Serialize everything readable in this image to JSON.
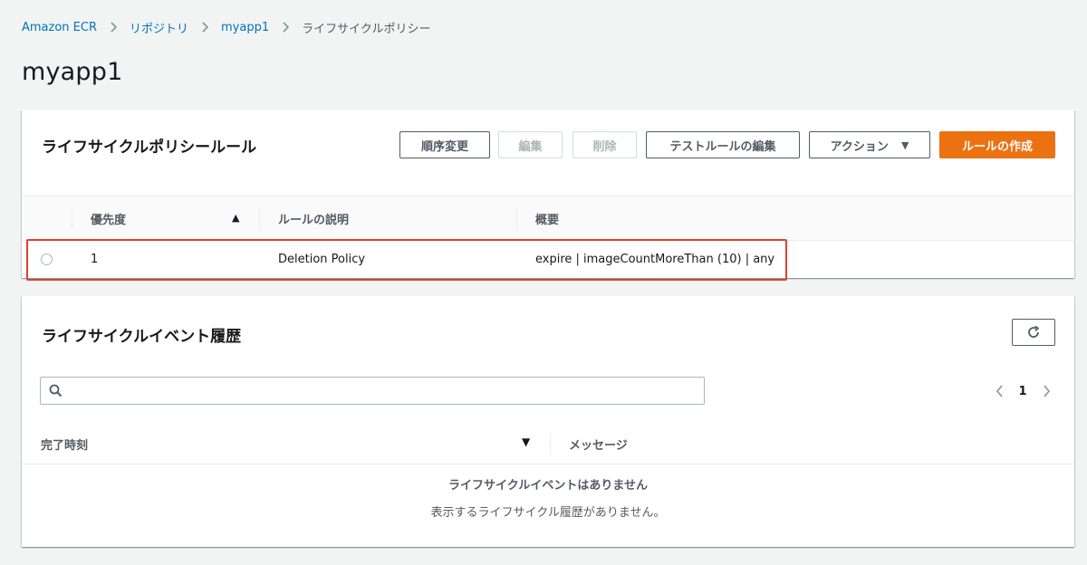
{
  "breadcrumb": {
    "items": [
      "Amazon ECR",
      "リポジトリ",
      "myapp1"
    ],
    "current": "ライフサイクルポリシー"
  },
  "page": {
    "title": "myapp1"
  },
  "rules_panel": {
    "title": "ライフサイクルポリシールール",
    "buttons": {
      "reorder": "順序変更",
      "edit": "編集",
      "delete": "削除",
      "edit_test_rules": "テストルールの編集",
      "actions": "アクション",
      "create_rule": "ルールの作成"
    },
    "columns": {
      "priority": "優先度",
      "description": "ルールの説明",
      "summary": "概要"
    },
    "rows": [
      {
        "priority": "1",
        "description": "Deletion Policy",
        "summary": "expire | imageCountMoreThan (10) | any"
      }
    ]
  },
  "events_panel": {
    "title": "ライフサイクルイベント履歴",
    "search": {
      "value": "",
      "placeholder": ""
    },
    "pagination": {
      "current_page": "1"
    },
    "columns": {
      "completed_time": "完了時刻",
      "message": "メッセージ"
    },
    "empty_title": "ライフサイクルイベントはありません",
    "empty_subtitle": "表示するライフサイクル履歴がありません。"
  },
  "colors": {
    "link": "#0073bb",
    "primary_button": "#ec7211",
    "highlight_border": "#e0412d",
    "background": "#f2f3f3"
  },
  "icons": [
    "chevron-right-icon",
    "caret-down-icon",
    "sort-ascending-icon",
    "refresh-icon",
    "search-icon",
    "chevron-left-icon",
    "sort-descending-icon",
    "radio-button"
  ]
}
